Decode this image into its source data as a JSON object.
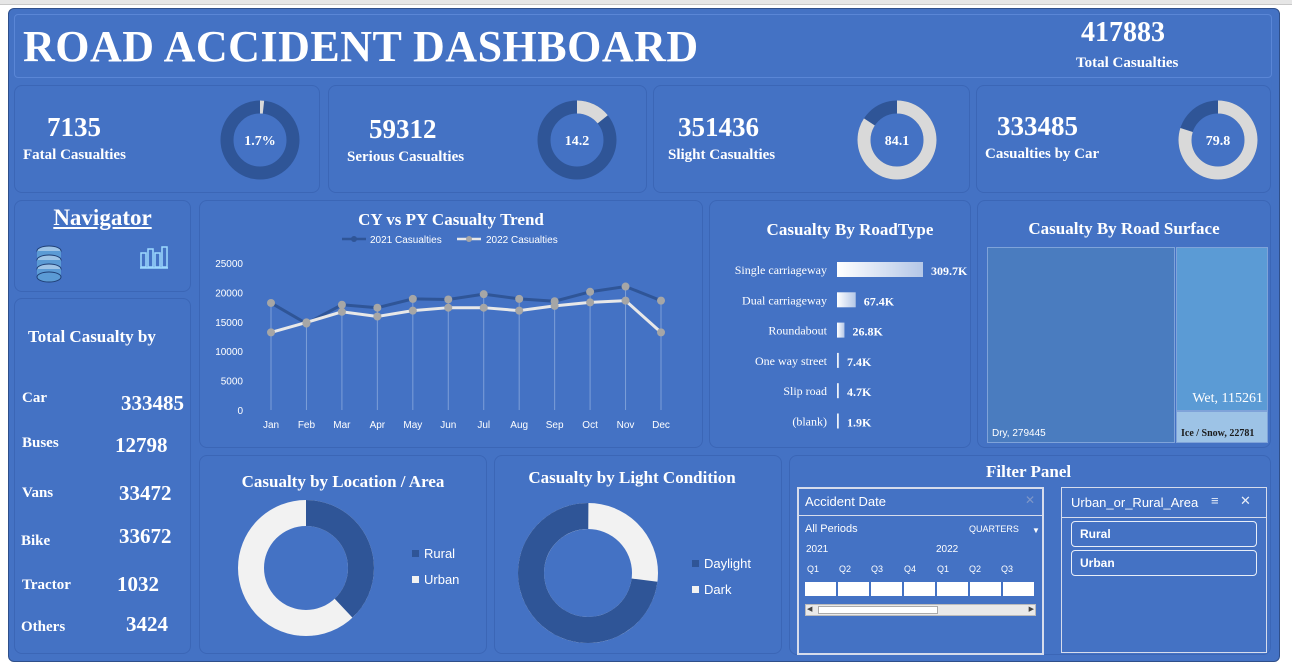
{
  "header": {
    "title": "ROAD ACCIDENT DASHBOARD",
    "total_value": "417883",
    "total_label": "Total Casualties"
  },
  "kpis": [
    {
      "value": "7135",
      "label": "Fatal Casualties",
      "donut_text": "1.7%",
      "pct": 1.7
    },
    {
      "value": "59312",
      "label": "Serious Casualties",
      "donut_text": "14.2",
      "pct": 14.2
    },
    {
      "value": "351436",
      "label": "Slight Casualties",
      "donut_text": "84.1",
      "pct": 84.1
    },
    {
      "value": "333485",
      "label": "Casualties by Car",
      "donut_text": "79.8",
      "pct": 79.8
    }
  ],
  "navigator": {
    "title": "Navigator",
    "icons": [
      "database-icon",
      "chart-icon"
    ]
  },
  "vehicle_panel": {
    "title": "Total Casualty by",
    "rows": [
      {
        "label": "Car",
        "value": "333485"
      },
      {
        "label": "Buses",
        "value": "12798"
      },
      {
        "label": "Vans",
        "value": "33472"
      },
      {
        "label": "Bike",
        "value": "33672"
      },
      {
        "label": "Tractor",
        "value": "1032"
      },
      {
        "label": "Others",
        "value": "3424"
      }
    ]
  },
  "colors": {
    "background": "#4472c4",
    "dark_series": "#2f5597",
    "light_series": "#d9d9d9",
    "treemap_dry": "#4a7cbf",
    "treemap_wet": "#5b9bd5",
    "treemap_ice": "#9dc3e6"
  },
  "chart_data": [
    {
      "type": "line",
      "title": "CY vs PY Casualty Trend",
      "categories": [
        "Jan",
        "Feb",
        "Mar",
        "Apr",
        "May",
        "Jun",
        "Jul",
        "Aug",
        "Sep",
        "Oct",
        "Nov",
        "Dec"
      ],
      "series": [
        {
          "name": "2021 Casualties",
          "values": [
            18200,
            14700,
            17900,
            17400,
            18900,
            18800,
            19700,
            18900,
            18500,
            20100,
            21000,
            18600
          ]
        },
        {
          "name": "2022 Casualties",
          "values": [
            13200,
            14900,
            16700,
            15900,
            16900,
            17400,
            17400,
            16900,
            17700,
            18300,
            18600,
            13200
          ]
        }
      ],
      "ylim": [
        0,
        25000
      ],
      "yticks": [
        "25000",
        "20000",
        "15000",
        "10000",
        "5000",
        "0"
      ],
      "legend": "top"
    },
    {
      "type": "bar",
      "title": "Casualty By RoadType",
      "categories": [
        "Single carriageway",
        "Dual carriageway",
        "Roundabout",
        "One way street",
        "Slip road",
        "(blank)"
      ],
      "values": [
        309700,
        67400,
        26800,
        7400,
        4700,
        1900
      ],
      "labels": [
        "309.7K",
        "67.4K",
        "26.8K",
        "7.4K",
        "4.7K",
        "1.9K"
      ]
    },
    {
      "type": "treemap",
      "title": "Casualty By Road Surface",
      "items": [
        {
          "label": "Dry, 279445",
          "value": 279445
        },
        {
          "label": "Wet, 115261",
          "value": 115261
        },
        {
          "label": "Ice / Snow, 22781",
          "value": 22781
        }
      ]
    },
    {
      "type": "pie",
      "title": "Casualty by Location / Area",
      "legend": [
        "Rural",
        "Urban"
      ],
      "values": [
        38,
        62
      ]
    },
    {
      "type": "pie",
      "title": "Casualty by Light Condition",
      "legend": [
        "Daylight",
        "Dark"
      ],
      "values": [
        73,
        27
      ]
    }
  ],
  "filter_panel": {
    "title": "Filter Panel",
    "timeline": {
      "title": "Accident Date",
      "periods_label": "All Periods",
      "granularity": "QUARTERS",
      "years": [
        "2021",
        "2022"
      ],
      "quarters": [
        "Q1",
        "Q2",
        "Q3",
        "Q4",
        "Q1",
        "Q2",
        "Q3"
      ]
    },
    "slicer": {
      "title": "Urban_or_Rural_Area",
      "items": [
        "Rural",
        "Urban"
      ]
    }
  }
}
